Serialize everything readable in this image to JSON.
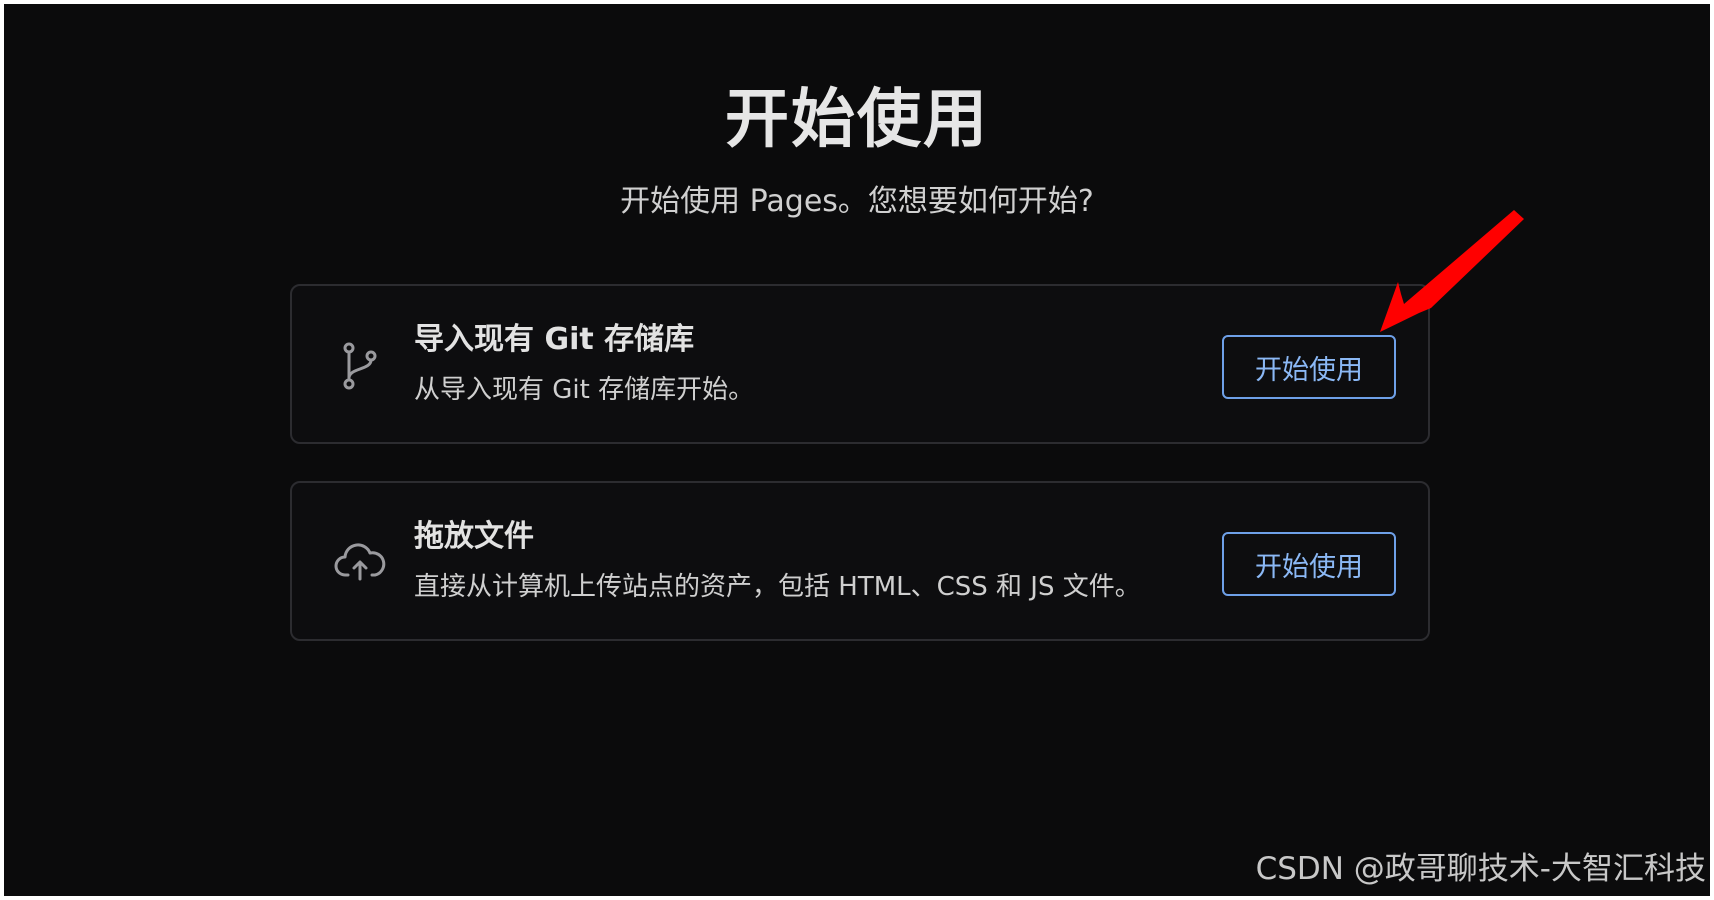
{
  "header": {
    "title": "开始使用",
    "subtitle": "开始使用 Pages。您想要如何开始?"
  },
  "cards": [
    {
      "icon": "git-branch-icon",
      "title": "导入现有 Git 存储库",
      "description": "从导入现有 Git 存储库开始。",
      "button_label": "开始使用"
    },
    {
      "icon": "cloud-upload-icon",
      "title": "拖放文件",
      "description": "直接从计算机上传站点的资产，包括 HTML、CSS 和 JS 文件。",
      "button_label": "开始使用"
    }
  ],
  "watermark": "CSDN @政哥聊技术-大智汇科技",
  "colors": {
    "background": "#0b0b0c",
    "card_border": "#2c2c30",
    "button_border": "#6ea0e8",
    "button_text": "#8bb8f5",
    "annotation_arrow": "#ff0000"
  }
}
